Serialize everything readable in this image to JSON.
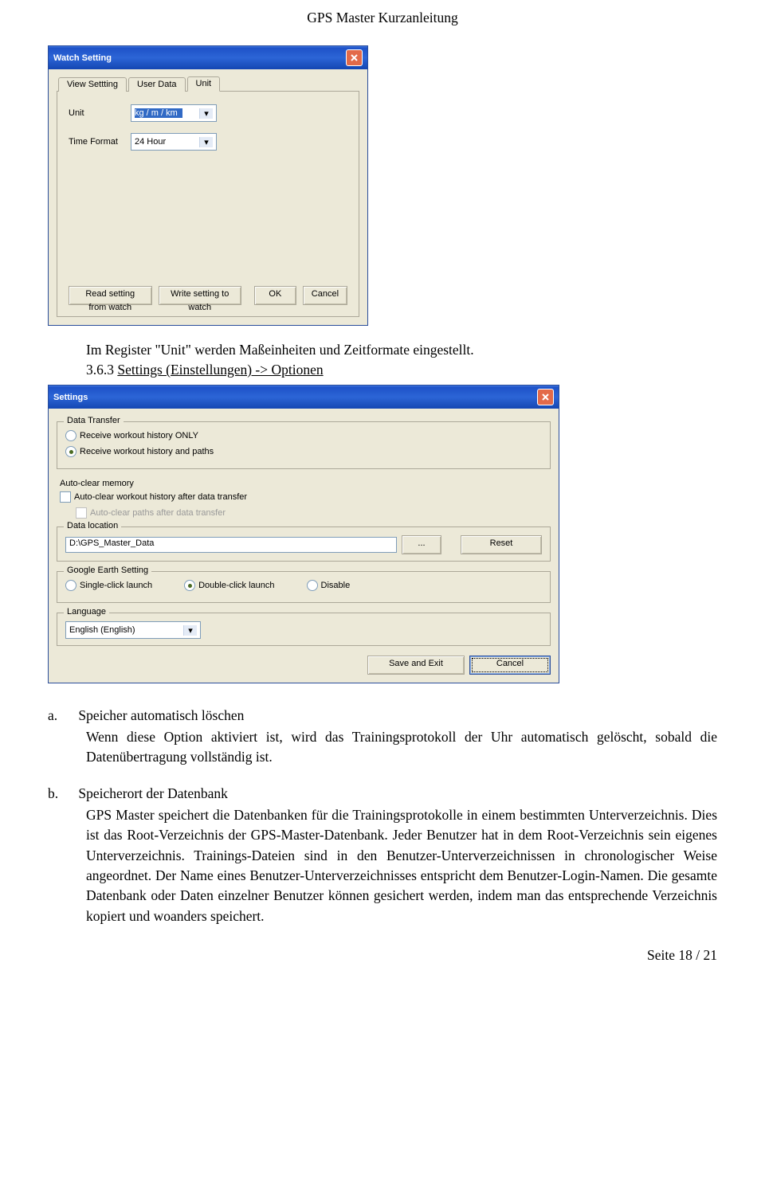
{
  "doc": {
    "header": "GPS Master Kurzanleitung",
    "footer": "Seite 18 / 21"
  },
  "dialog1": {
    "title": "Watch Setting",
    "tabs": {
      "t1": "View Settting",
      "t2": "User Data",
      "t3": "Unit"
    },
    "fields": {
      "unit_label": "Unit",
      "unit_value": "kg / m / km",
      "time_label": "Time Format",
      "time_value": "24 Hour"
    },
    "buttons": {
      "read": "Read setting from watch",
      "write": "Write setting to watch",
      "ok": "OK",
      "cancel": "Cancel"
    }
  },
  "body1": {
    "line1": "Im Register \"Unit\" werden Maßeinheiten und Zeitformate eingestellt.",
    "line2_num": "3.6.3 ",
    "line2_text": "Settings (Einstellungen) -> Optionen"
  },
  "dialog2": {
    "title": "Settings",
    "groups": {
      "dt": {
        "title": "Data Transfer",
        "opt1": "Receive workout history ONLY",
        "opt2": "Receive workout history and paths"
      },
      "ac": {
        "title": "Auto-clear  memory",
        "chk1": "Auto-clear workout history after data transfer",
        "chk2": "Auto-clear paths after data transfer"
      },
      "dl": {
        "title": "Data location",
        "value": "D:\\GPS_Master_Data",
        "browse": "...",
        "reset": "Reset"
      },
      "ge": {
        "title": "Google Earth Setting",
        "o1": "Single-click launch",
        "o2": "Double-click launch",
        "o3": "Disable"
      },
      "lang": {
        "title": "Language",
        "value": "English (English)"
      }
    },
    "buttons": {
      "save": "Save and Exit",
      "cancel": "Cancel"
    }
  },
  "body2": {
    "a_letter": "a.",
    "a_title": "Speicher automatisch löschen",
    "a_text": "Wenn diese Option aktiviert ist, wird das Trainingsprotokoll der Uhr automatisch gelöscht, sobald die Datenübertragung vollständig ist.",
    "b_letter": "b.",
    "b_title": "Speicherort der Datenbank",
    "b_text": "GPS Master speichert die Datenbanken für die Trainingsprotokolle in einem bestimmten Unterverzeichnis. Dies ist das Root-Verzeichnis der GPS-Master-Datenbank. Jeder Benutzer hat in dem Root-Verzeichnis sein eigenes Unterverzeichnis. Trainings-Dateien sind in den Benutzer-Unterverzeichnissen in chronologischer Weise angeordnet. Der Name eines Benutzer-Unterverzeichnisses entspricht dem Benutzer-Login-Namen. Die gesamte Datenbank oder Daten einzelner Benutzer können gesichert werden, indem man das entsprechende Verzeichnis kopiert und woanders speichert."
  }
}
